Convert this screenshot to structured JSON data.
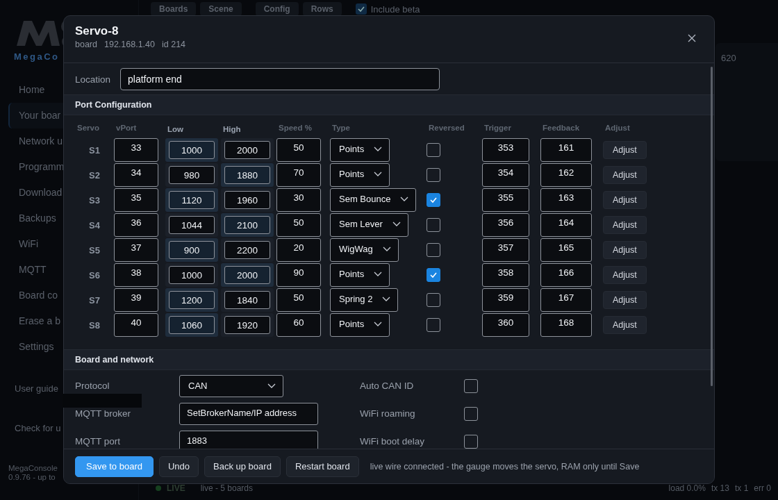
{
  "app": {
    "logo_text": "MegaCo",
    "sidebar": [
      {
        "label": "Home",
        "selected": false
      },
      {
        "label": "Your boar",
        "selected": true
      },
      {
        "label": "Network u",
        "selected": false
      },
      {
        "label": "Programm",
        "selected": false
      },
      {
        "label": "Download",
        "selected": false
      },
      {
        "label": "Backups",
        "selected": false
      },
      {
        "label": "WiFi",
        "selected": false
      },
      {
        "label": "MQTT",
        "selected": false
      },
      {
        "label": "Board co",
        "selected": false
      },
      {
        "label": "Erase a b",
        "selected": false
      },
      {
        "label": "Settings",
        "selected": false
      }
    ],
    "links": [
      "User guide",
      "Check for u"
    ],
    "version": [
      "MegaConsole",
      "0.9.76 - up to"
    ],
    "toolbar": {
      "buttons": [
        "Boards",
        "Scene",
        "Config",
        "Rows"
      ],
      "include_beta": {
        "label": "Include beta",
        "checked": true
      }
    },
    "card_text": "620",
    "status_bar": {
      "live": "LIVE",
      "boards": "live - 5 boards",
      "stats": [
        "load 0.0%",
        "tx 13",
        "tx 1",
        "err 0"
      ]
    }
  },
  "dialog": {
    "title": "Servo-8",
    "meta": [
      "board",
      "192.168.1.40",
      "id 214"
    ],
    "location": {
      "label": "Location",
      "value": "platform end"
    },
    "port_configuration": {
      "title": "Port Configuration",
      "columns": [
        "Servo",
        "vPort",
        "Low",
        "High",
        "Speed %",
        "Type",
        "Reversed",
        "Trigger",
        "Feedback",
        "Adjust"
      ],
      "rows": [
        {
          "servo": "S1",
          "vport": "33",
          "low": "1000",
          "high": "2000",
          "low_active": true,
          "high_active": false,
          "speed": "50",
          "type": "Points",
          "reversed": false,
          "trigger": "353",
          "feedback": "161",
          "adjust": "Adjust"
        },
        {
          "servo": "S2",
          "vport": "34",
          "low": "980",
          "high": "1880",
          "low_active": false,
          "high_active": true,
          "speed": "70",
          "type": "Points",
          "reversed": false,
          "trigger": "354",
          "feedback": "162",
          "adjust": "Adjust"
        },
        {
          "servo": "S3",
          "vport": "35",
          "low": "1120",
          "high": "1960",
          "low_active": true,
          "high_active": false,
          "speed": "30",
          "type": "Sem Bounce",
          "reversed": true,
          "trigger": "355",
          "feedback": "163",
          "adjust": "Adjust"
        },
        {
          "servo": "S4",
          "vport": "36",
          "low": "1044",
          "high": "2100",
          "low_active": false,
          "high_active": true,
          "speed": "50",
          "type": "Sem Lever",
          "reversed": false,
          "trigger": "356",
          "feedback": "164",
          "adjust": "Adjust"
        },
        {
          "servo": "S5",
          "vport": "37",
          "low": "900",
          "high": "2200",
          "low_active": true,
          "high_active": false,
          "speed": "20",
          "type": "WigWag",
          "reversed": false,
          "trigger": "357",
          "feedback": "165",
          "adjust": "Adjust"
        },
        {
          "servo": "S6",
          "vport": "38",
          "low": "1000",
          "high": "2000",
          "low_active": false,
          "high_active": true,
          "speed": "90",
          "type": "Points",
          "reversed": true,
          "trigger": "358",
          "feedback": "166",
          "adjust": "Adjust"
        },
        {
          "servo": "S7",
          "vport": "39",
          "low": "1200",
          "high": "1840",
          "low_active": true,
          "high_active": false,
          "speed": "50",
          "type": "Spring 2",
          "reversed": false,
          "trigger": "359",
          "feedback": "167",
          "adjust": "Adjust"
        },
        {
          "servo": "S8",
          "vport": "40",
          "low": "1060",
          "high": "1920",
          "low_active": true,
          "high_active": false,
          "speed": "60",
          "type": "Points",
          "reversed": false,
          "trigger": "360",
          "feedback": "168",
          "adjust": "Adjust"
        }
      ]
    },
    "board_and_network": {
      "title": "Board and network",
      "fields": [
        {
          "label": "Protocol",
          "kind": "select",
          "value": "CAN"
        },
        {
          "label": "MQTT broker",
          "kind": "text",
          "value": "SetBrokerName/IP address"
        },
        {
          "label": "MQTT port",
          "kind": "text",
          "value": "1883"
        }
      ],
      "options": [
        {
          "label": "Auto CAN ID",
          "checked": false
        },
        {
          "label": "WiFi roaming",
          "checked": false
        },
        {
          "label": "WiFi boot delay",
          "checked": false
        }
      ]
    },
    "footer": {
      "buttons": [
        {
          "label": "Save to board",
          "primary": true
        },
        {
          "label": "Undo",
          "primary": false
        },
        {
          "label": "Back up board",
          "primary": false
        },
        {
          "label": "Restart board",
          "primary": false
        }
      ],
      "message": "live wire connected - the gauge moves the servo, RAM only until Save"
    }
  }
}
